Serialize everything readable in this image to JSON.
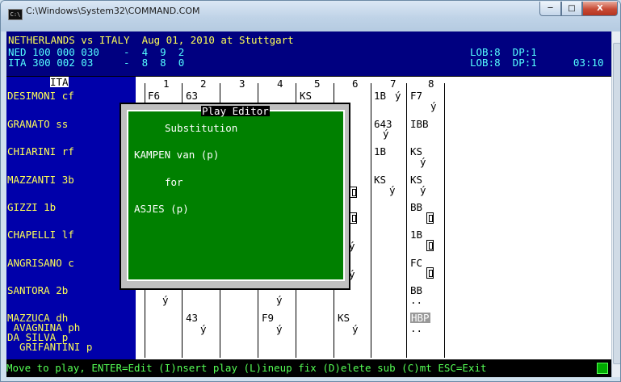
{
  "window": {
    "title": "C:\\Windows\\System32\\COMMAND.COM",
    "app_icon": "C:\\",
    "minimize_glyph": "─",
    "maximize_glyph": "□",
    "close_glyph": "X"
  },
  "header": {
    "line1": "NETHERLANDS vs ITALY  Aug 01, 2010 at Stuttgart",
    "line2_left": "NED 100 000 030    -  4  9  2",
    "line2_right": "LOB:8  DP:1",
    "line3_left": "ITA 300 002 03     -  8  8  0",
    "line3_right": "LOB:8  DP:1      03:10"
  },
  "scorecard": {
    "team_header": "ITA",
    "innings": [
      "1",
      "2",
      "3",
      "4",
      "5",
      "6",
      "7",
      "8"
    ],
    "players": [
      "DESIMONI cf",
      "GRANATO ss",
      "CHIARINI rf",
      "MAZZANTI 3b",
      "GIZZI 1b",
      "CHAPELLI lf",
      "ANGRISANO c",
      "SANTORA 2b",
      "MAZZUCA dh",
      " AVAGNINA ph",
      "DA SILVA p",
      "  GRIFANTINI p"
    ],
    "cells": {
      "r1_i1": "F6",
      "r1_i2": "63",
      "r1_i4": "KS",
      "r1_i7": "1B",
      "r1_i7_mark": "ý",
      "r1_i8": "F7",
      "r1_i8_mark": "ý",
      "r2_i7": "643",
      "r2_i7_mark": "ý",
      "r2_i8": "IBB",
      "r3_i7": "1B",
      "r3_i8": "KS",
      "r3_i8_mark": "ý",
      "r4_i7": "KS",
      "r4_i7_mark": "ý",
      "r4_i8": "KS",
      "r4_i8_mark": "ý",
      "r5_i8": "BB",
      "r6_i8": "1B",
      "r6_i6_mark": "ý",
      "r7_i8": "FC",
      "r7_i6_mark": "ý",
      "r8_i8": "BB",
      "r8_i1_mark": "ý",
      "r8_i3_mark": "ý",
      "r8_i8_dots": "..",
      "r9_i2": "43",
      "r9_i2_mark": "ý",
      "r9_i4": "F9",
      "r9_i4_mark": "ý",
      "r9_i6": "KS",
      "r9_i6_mark": "ý",
      "r9_i8": "HBP",
      "r9_i8_dots": ".."
    }
  },
  "play_editor": {
    "title": "Play Editor",
    "heading": "Substitution",
    "incoming": "KAMPEN van (p)",
    "connector": "for",
    "outgoing": "ASJES (p)"
  },
  "status_bar": {
    "text": "Move to play, ENTER=Edit (I)nsert play (L)ineup fix (D)elete sub (C)mt ESC=Exit"
  },
  "colors": {
    "header_bg": "#000080",
    "sidebar_bg": "#0000aa",
    "player_text": "#ffff55",
    "dialog_bg": "#008000",
    "status_text": "#55ff55"
  }
}
